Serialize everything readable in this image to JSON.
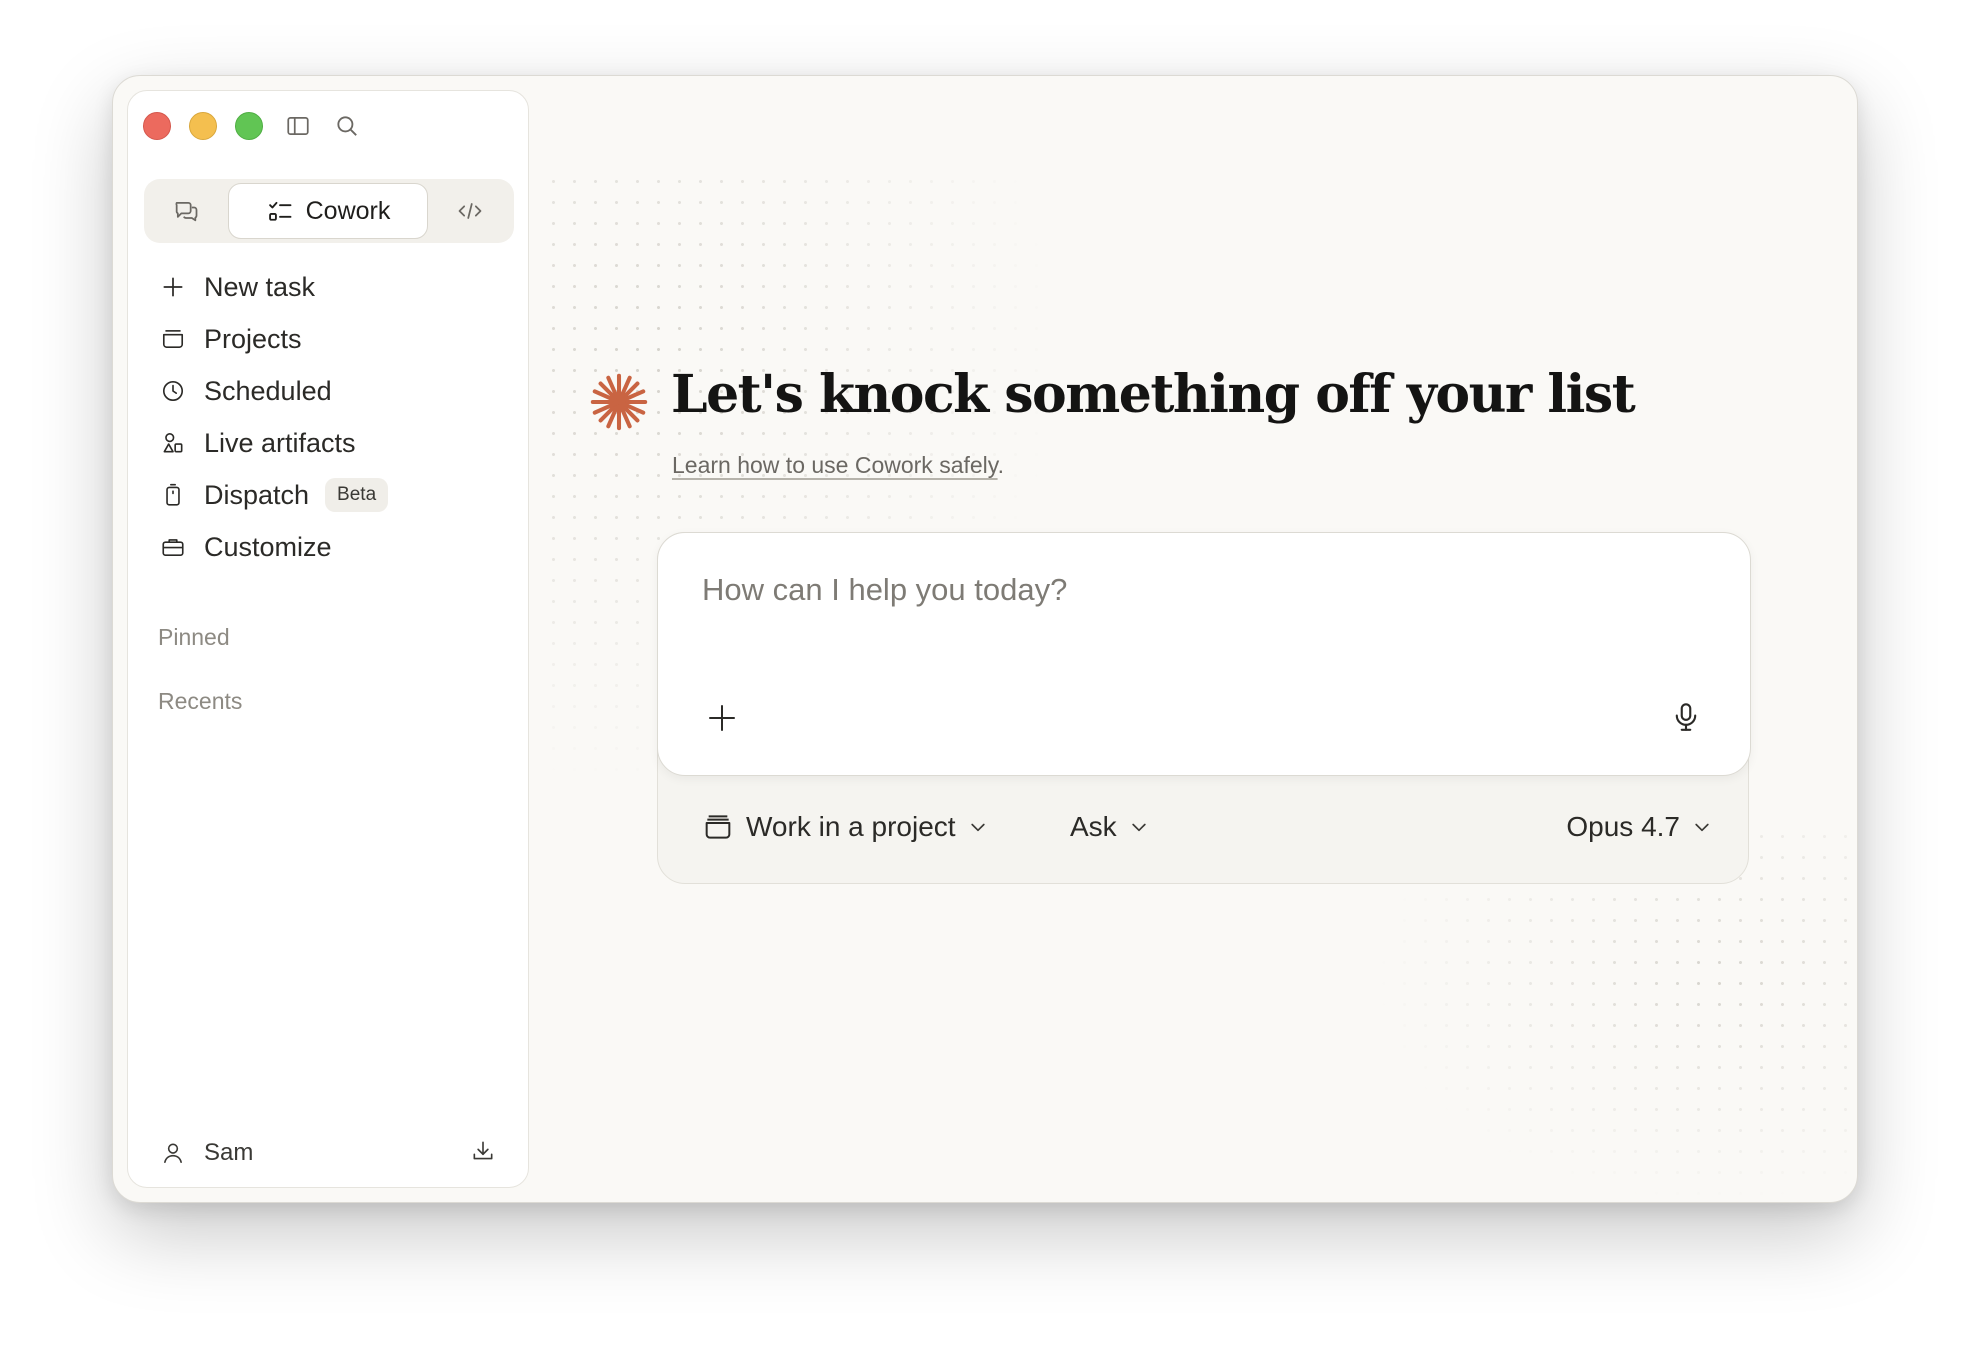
{
  "sidebar": {
    "mode_switch": {
      "active_label": "Cowork"
    },
    "nav": [
      {
        "label": "New task",
        "icon": "plus-icon"
      },
      {
        "label": "Projects",
        "icon": "projects-icon"
      },
      {
        "label": "Scheduled",
        "icon": "clock-icon"
      },
      {
        "label": "Live artifacts",
        "icon": "shapes-icon"
      },
      {
        "label": "Dispatch",
        "icon": "phone-icon",
        "badge": "Beta"
      },
      {
        "label": "Customize",
        "icon": "briefcase-icon"
      }
    ],
    "pinned_label": "Pinned",
    "recents_label": "Recents",
    "user": {
      "name": "Sam"
    }
  },
  "main": {
    "title": "Let's knock something off your list",
    "learn_link": "Learn how to use Cowork safely",
    "learn_suffix": ".",
    "composer": {
      "placeholder": "How can I help you today?"
    },
    "bottom_bar": {
      "project_label": "Work in a project",
      "mode_label": "Ask",
      "model_label": "Opus 4.7"
    }
  },
  "colors": {
    "accent": "#c96442",
    "background": "#faf9f6"
  }
}
